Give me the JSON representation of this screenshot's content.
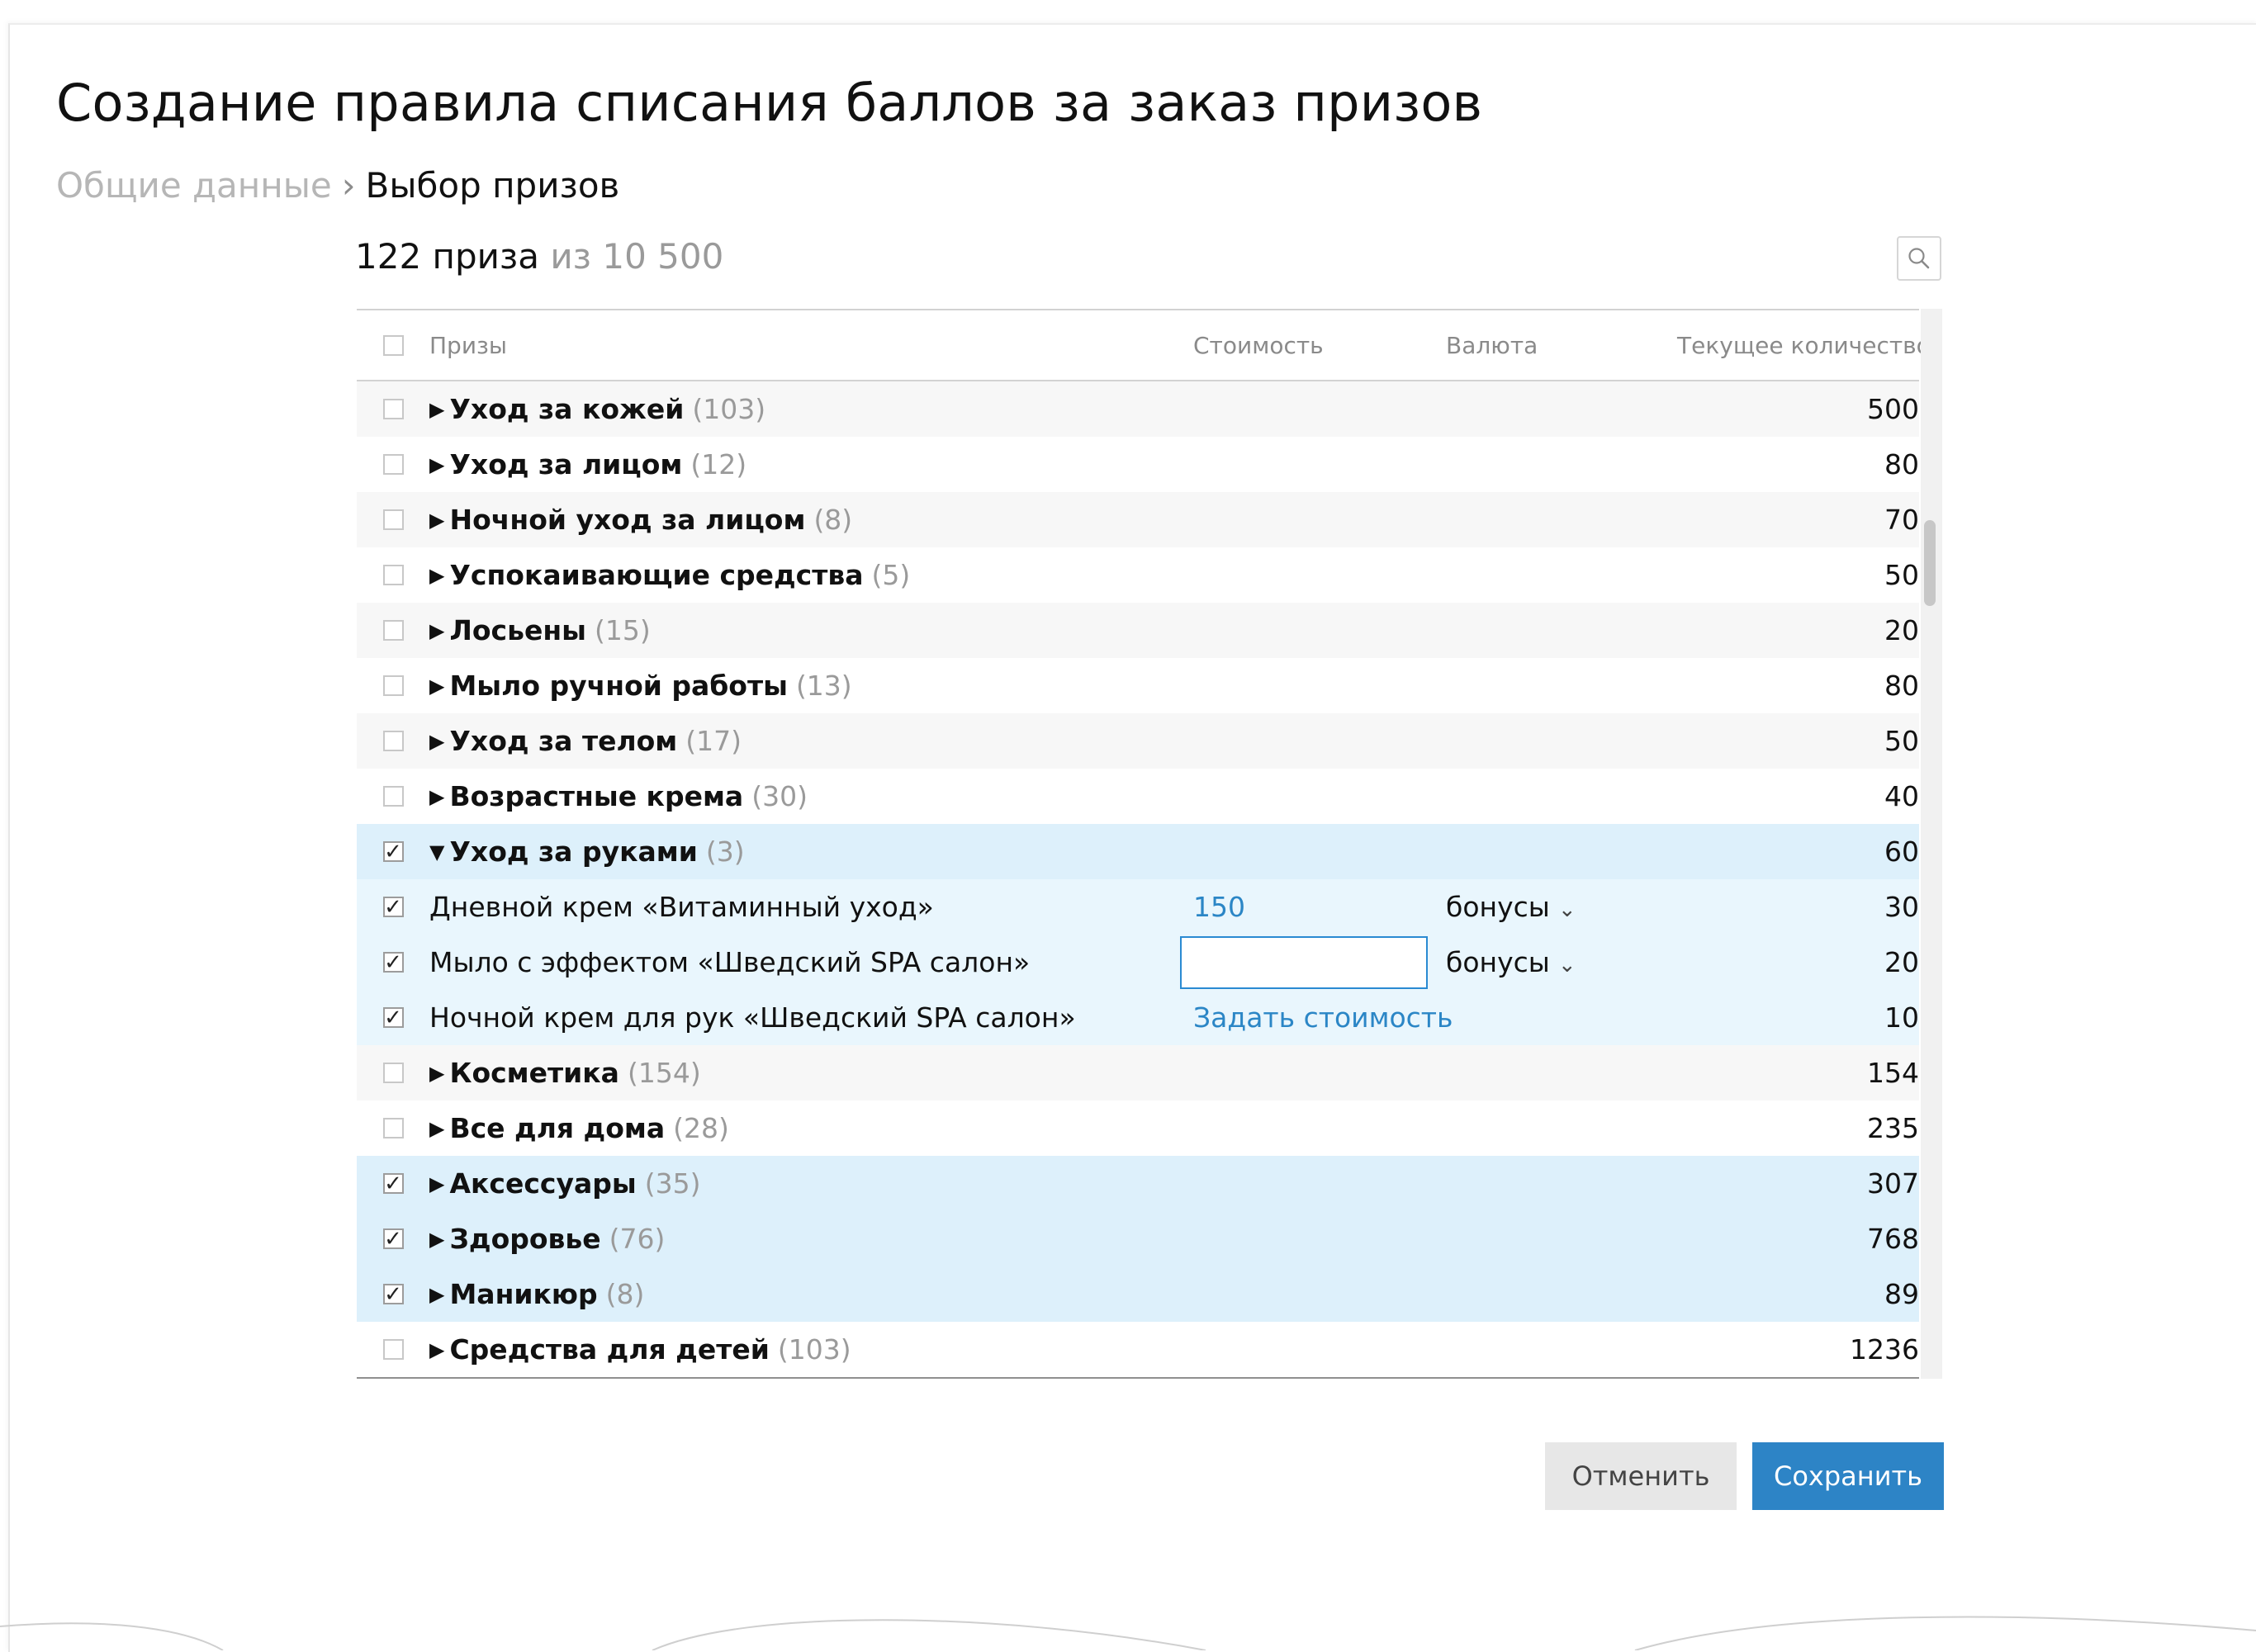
{
  "page": {
    "title": "Создание правила списания баллов за заказ призов",
    "breadcrumb": {
      "step1": "Общие данные",
      "separator": "›",
      "step2": "Выбор призов"
    },
    "counter": {
      "selected": "122 приза",
      "total": "из 10 500"
    }
  },
  "search": {
    "icon": "search-icon"
  },
  "table": {
    "headers": {
      "name": "Призы",
      "cost": "Стоимость",
      "currency": "Валюта",
      "qty": "Текущее количество"
    },
    "rows": [
      {
        "type": "group",
        "name": "Уход за кожей",
        "count": "(103)",
        "qty": "500",
        "checked": false,
        "expanded": false
      },
      {
        "type": "group",
        "name": "Уход за лицом",
        "count": "(12)",
        "qty": "80",
        "checked": false,
        "expanded": false
      },
      {
        "type": "group",
        "name": "Ночной уход за лицом",
        "count": "(8)",
        "qty": "70",
        "checked": false,
        "expanded": false
      },
      {
        "type": "group",
        "name": "Успокаивающие средства",
        "count": "(5)",
        "qty": "50",
        "checked": false,
        "expanded": false
      },
      {
        "type": "group",
        "name": "Лосьены",
        "count": "(15)",
        "qty": "20",
        "checked": false,
        "expanded": false
      },
      {
        "type": "group",
        "name": "Мыло ручной работы",
        "count": "(13)",
        "qty": "80",
        "checked": false,
        "expanded": false
      },
      {
        "type": "group",
        "name": "Уход за телом",
        "count": "(17)",
        "qty": "50",
        "checked": false,
        "expanded": false
      },
      {
        "type": "group",
        "name": "Возрастные крема",
        "count": "(30)",
        "qty": "40",
        "checked": false,
        "expanded": false
      },
      {
        "type": "group",
        "name": "Уход за руками",
        "count": "(3)",
        "qty": "60",
        "checked": true,
        "expanded": true
      },
      {
        "type": "item",
        "name": "Дневной крем «Витаминный уход»",
        "cost": "150",
        "currency": "бонусы",
        "qty": "30",
        "checked": true
      },
      {
        "type": "item",
        "name": "Мыло с эффектом «Шведский SPA салон»",
        "cost_input": "",
        "currency": "бонусы",
        "qty": "20",
        "checked": true
      },
      {
        "type": "item",
        "name": "Ночной крем для рук «Шведский SPA салон»",
        "cost_link": "Задать стоимость",
        "qty": "10",
        "checked": true
      },
      {
        "type": "group",
        "name": "Косметика",
        "count": "(154)",
        "qty": "154",
        "checked": false,
        "expanded": false
      },
      {
        "type": "group",
        "name": "Все для дома",
        "count": "(28)",
        "qty": "235",
        "checked": false,
        "expanded": false
      },
      {
        "type": "group",
        "name": "Аксессуары",
        "count": "(35)",
        "qty": "307",
        "checked": true,
        "expanded": false
      },
      {
        "type": "group",
        "name": "Здоровье",
        "count": "(76)",
        "qty": "768",
        "checked": true,
        "expanded": false
      },
      {
        "type": "group",
        "name": "Маникюр",
        "count": "(8)",
        "qty": "89",
        "checked": true,
        "expanded": false
      },
      {
        "type": "group",
        "name": "Средства для детей",
        "count": "(103)",
        "qty": "1236",
        "checked": false,
        "expanded": false
      }
    ]
  },
  "buttons": {
    "cancel": "Отменить",
    "save": "Сохранить"
  },
  "colors": {
    "accent": "#2d84c6",
    "link": "#2b86c6",
    "selected_row": "#ddf0fb",
    "muted_text": "#9a9a9a"
  }
}
